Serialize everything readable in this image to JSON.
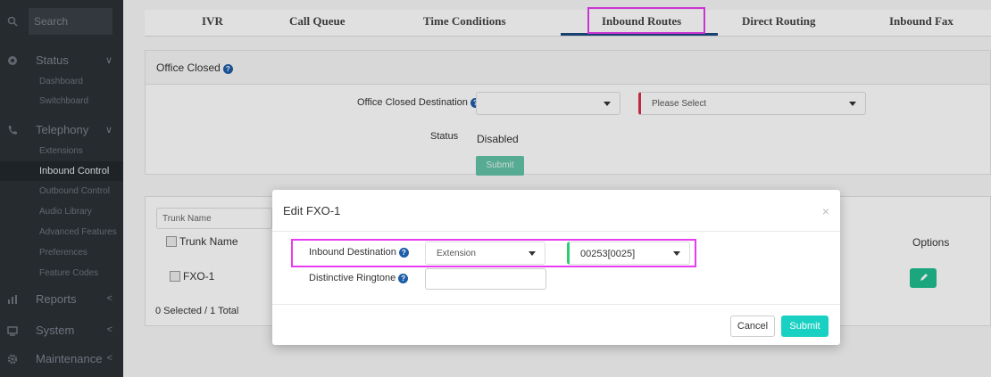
{
  "sidebar": {
    "search_placeholder": "Search",
    "groups": [
      {
        "label": "Status",
        "chevron": "∨",
        "icon": "dashboard-icon"
      },
      {
        "label": "Telephony",
        "chevron": "∨",
        "icon": "phone-icon"
      },
      {
        "label": "Reports",
        "chevron": "<",
        "icon": "bar-chart-icon"
      },
      {
        "label": "System",
        "chevron": "<",
        "icon": "system-icon"
      },
      {
        "label": "Maintenance",
        "chevron": "<",
        "icon": "gear-icon"
      }
    ],
    "status_items": [
      "Dashboard",
      "Switchboard"
    ],
    "telephony_items": [
      "Extensions",
      "Inbound Control",
      "Outbound Control",
      "Audio Library",
      "Advanced Features",
      "Preferences",
      "Feature Codes"
    ],
    "active_item": "Inbound Control"
  },
  "tabs": [
    "IVR",
    "Call Queue",
    "Time Conditions",
    "Inbound Routes",
    "Direct Routing",
    "Inbound Fax"
  ],
  "active_tab": "Inbound Routes",
  "office_closed": {
    "title": "Office Closed",
    "destination_label": "Office Closed Destination",
    "destination_value": "",
    "destination_target": "Please Select",
    "status_label": "Status",
    "status_value": "Disabled",
    "submit_label": "Submit"
  },
  "trunk_table": {
    "filter_placeholder": "Trunk Name",
    "header_name": "Trunk Name",
    "header_options": "Options",
    "rows": [
      {
        "name": "FXO-1"
      }
    ],
    "footer": "0 Selected / 1 Total"
  },
  "modal": {
    "title": "Edit FXO-1",
    "close": "×",
    "inbound_destination_label": "Inbound Destination",
    "inbound_destination_type": "Extension",
    "inbound_destination_value": "00253[0025]",
    "ringtone_label": "Distinctive Ringtone",
    "ringtone_value": "",
    "cancel_label": "Cancel",
    "submit_label": "Submit"
  },
  "colors": {
    "sidebar_bg": "#2c3136",
    "accent_teal": "#19d1c2",
    "tab_underline": "#1c4b82",
    "highlight": "#e83cf0",
    "help_icon": "#1d5ea8"
  }
}
